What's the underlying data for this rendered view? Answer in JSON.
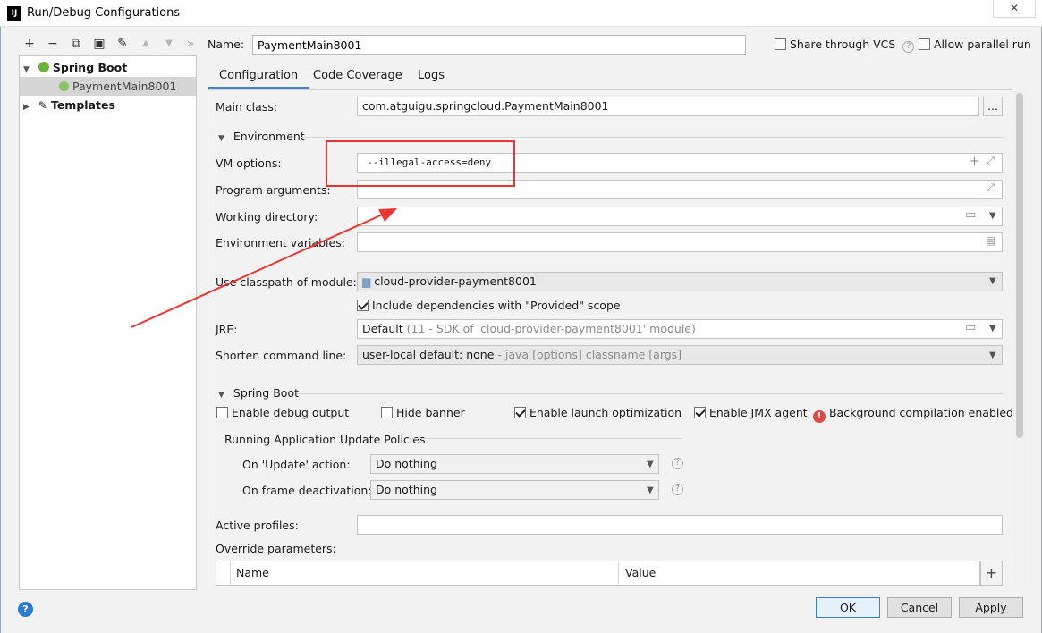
{
  "window": {
    "title": "Run/Debug Configurations",
    "icon_label": "IJ",
    "close_glyph": "✕"
  },
  "toolbar": {
    "add": "+",
    "remove": "−",
    "copy": "⧉",
    "save": "▣",
    "edit": "✎",
    "up": "▲",
    "down": "▼",
    "more": "»"
  },
  "tree": {
    "groups": [
      {
        "label": "Spring Boot",
        "expanded": true,
        "children": [
          {
            "label": "PaymentMain8001",
            "selected": true
          }
        ]
      },
      {
        "label": "Templates",
        "expanded": false
      }
    ]
  },
  "header": {
    "name_label": "Name:",
    "name_value": "PaymentMain8001",
    "share_vcs_label": "Share through VCS",
    "share_vcs_checked": false,
    "parallel_label": "Allow parallel run",
    "parallel_checked": false
  },
  "tabs": [
    {
      "label": "Configuration",
      "active": true
    },
    {
      "label": "Code Coverage",
      "active": false
    },
    {
      "label": "Logs",
      "active": false
    }
  ],
  "form": {
    "main_class_label": "Main class:",
    "main_class_value": "com.atguigu.springcloud.PaymentMain8001",
    "browse_button": "...",
    "environment_section": "Environment",
    "vm_options_label": "VM options:",
    "vm_options_value": "--illegal-access=deny",
    "program_args_label": "Program arguments:",
    "program_args_value": "",
    "working_dir_label": "Working directory:",
    "working_dir_value": "",
    "env_vars_label": "Environment variables:",
    "env_vars_value": "",
    "classpath_label": "Use classpath of module:",
    "classpath_value": "cloud-provider-payment8001",
    "include_provided_label": "Include dependencies with \"Provided\" scope",
    "include_provided_checked": true,
    "jre_label": "JRE:",
    "jre_value": "Default",
    "jre_hint": "(11 - SDK of 'cloud-provider-payment8001' module)",
    "shorten_label": "Shorten command line:",
    "shorten_value": "user-local default: none",
    "shorten_hint": "- java [options] classname [args]"
  },
  "spring_boot": {
    "section": "Spring Boot",
    "debug_output_label": "Enable debug output",
    "debug_output_checked": false,
    "hide_banner_label": "Hide banner",
    "hide_banner_checked": false,
    "launch_opt_label": "Enable launch optimization",
    "launch_opt_checked": true,
    "jmx_label": "Enable JMX agent",
    "jmx_checked": true,
    "bg_compile_label": "Background compilation enabled",
    "update_policies_section": "Running Application Update Policies",
    "on_update_label": "On 'Update' action:",
    "on_update_value": "Do nothing",
    "on_frame_label": "On frame deactivation:",
    "on_frame_value": "Do nothing",
    "active_profiles_label": "Active profiles:",
    "active_profiles_value": "",
    "override_label": "Override parameters:",
    "table_columns": [
      "Name",
      "Value"
    ]
  },
  "footer": {
    "help": "?",
    "ok": "OK",
    "cancel": "Cancel",
    "apply": "Apply"
  },
  "colors": {
    "accent": "#4083c9",
    "annotation": "#ee3333",
    "error": "#e04646"
  }
}
